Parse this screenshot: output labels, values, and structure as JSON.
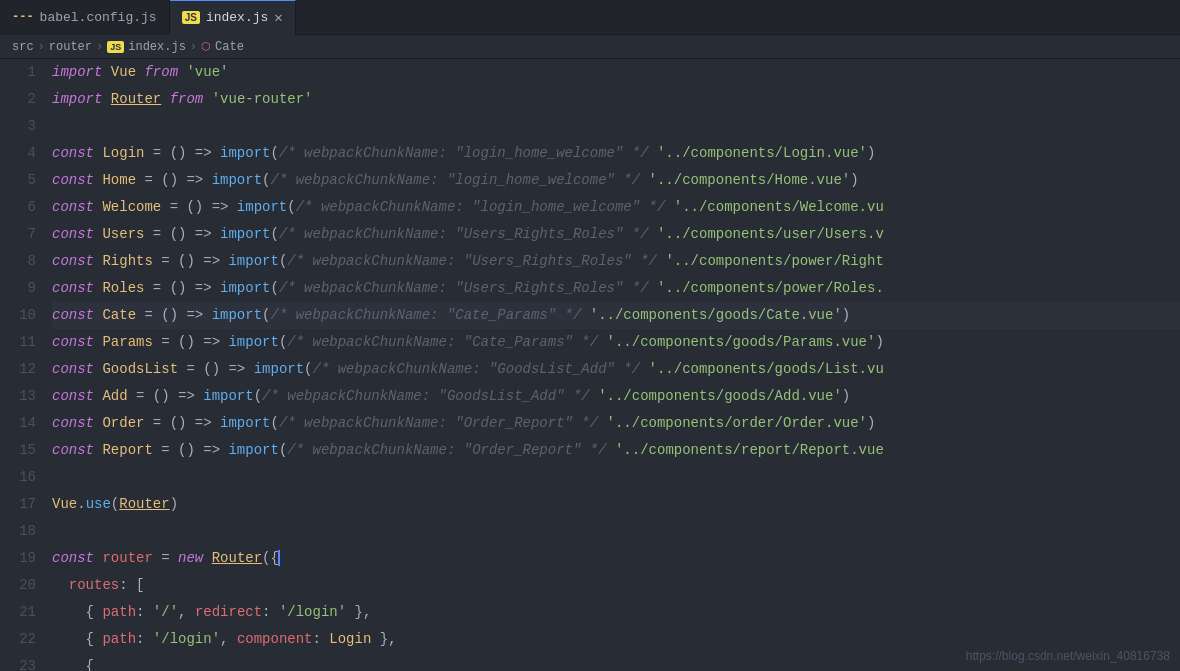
{
  "tabs": [
    {
      "id": "babel",
      "label": "babel.config.js",
      "icon": "babel",
      "active": false,
      "closable": false
    },
    {
      "id": "index",
      "label": "index.js",
      "icon": "js",
      "active": true,
      "closable": true
    }
  ],
  "breadcrumb": {
    "parts": [
      "src",
      "router",
      "index.js",
      "Cate"
    ]
  },
  "lines": [
    {
      "num": 1,
      "content": "import Vue from 'vue'"
    },
    {
      "num": 2,
      "content": "import Router from 'vue-router'"
    },
    {
      "num": 3,
      "content": ""
    },
    {
      "num": 4,
      "content": "const Login = () => import(/* webpackChunkName: \"login_home_welcome\" */ '../components/Login.vue')"
    },
    {
      "num": 5,
      "content": "const Home = () => import(/* webpackChunkName: \"login_home_welcome\" */ '../components/Home.vue')"
    },
    {
      "num": 6,
      "content": "const Welcome = () => import(/* webpackChunkName: \"login_home_welcome\" */ '../components/Welcome.vu"
    },
    {
      "num": 7,
      "content": "const Users = () => import(/* webpackChunkName: \"Users_Rights_Roles\" */ '../components/user/Users.v"
    },
    {
      "num": 8,
      "content": "const Rights = () => import(/* webpackChunkName: \"Users_Rights_Roles\" */ '../components/power/Right"
    },
    {
      "num": 9,
      "content": "const Roles = () => import(/* webpackChunkName: \"Users_Rights_Roles\" */ '../components/power/Roles."
    },
    {
      "num": 10,
      "content": "const Cate = () => import(/* webpackChunkName: \"Cate_Params\" */ '../components/goods/Cate.vue')",
      "highlight": true
    },
    {
      "num": 11,
      "content": "const Params = () => import(/* webpackChunkName: \"Cate_Params\" */ '../components/goods/Params.vue')"
    },
    {
      "num": 12,
      "content": "const GoodsList = () => import(/* webpackChunkName: \"GoodsList_Add\" */ '../components/goods/List.vu"
    },
    {
      "num": 13,
      "content": "const Add = () => import(/* webpackChunkName: \"GoodsList_Add\" */ '../components/goods/Add.vue')"
    },
    {
      "num": 14,
      "content": "const Order = () => import(/* webpackChunkName: \"Order_Report\" */ '../components/order/Order.vue')"
    },
    {
      "num": 15,
      "content": "const Report = () => import(/* webpackChunkName: \"Order_Report\" */ '../components/report/Report.vue"
    },
    {
      "num": 16,
      "content": ""
    },
    {
      "num": 17,
      "content": "Vue.use(Router)"
    },
    {
      "num": 18,
      "content": ""
    },
    {
      "num": 19,
      "content": "const router = new Router({"
    },
    {
      "num": 20,
      "content": "  routes: ["
    },
    {
      "num": 21,
      "content": "    { path: '/', redirect: '/login' },"
    },
    {
      "num": 22,
      "content": "    { path: '/login', component: Login },"
    },
    {
      "num": 23,
      "content": "    {"
    }
  ],
  "watermark": "https://blog.csdn.net/weixin_40816738"
}
